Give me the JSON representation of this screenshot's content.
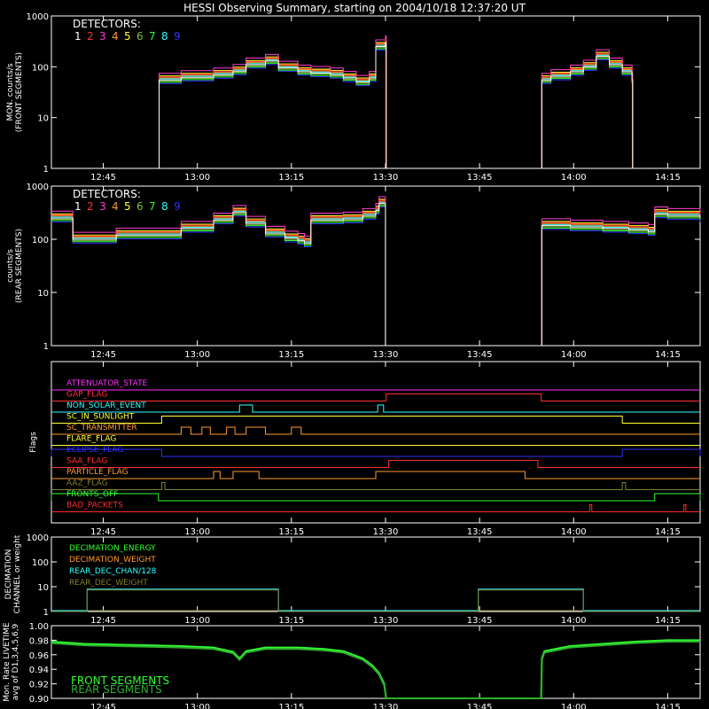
{
  "title": "HESSI Observing Summary, starting on 2004/10/18 12:37:20 UT",
  "colors": {
    "det": [
      "#ffffff",
      "#ff3030",
      "#ff3fd0",
      "#ff9a30",
      "#ffff30",
      "#7fbf3f",
      "#30ff30",
      "#30ffff",
      "#3030ff"
    ],
    "axis": "#ffffff"
  },
  "detectors_label": "DETECTORS:",
  "detector_numbers": [
    "1",
    "2",
    "3",
    "4",
    "5",
    "6",
    "7",
    "8",
    "9"
  ],
  "time_ticks": [
    "12:45",
    "13:00",
    "13:15",
    "13:30",
    "13:45",
    "14:00",
    "14:15"
  ],
  "chart_data": [
    {
      "id": "front",
      "type": "line",
      "ylabel": [
        "MON. counts/s",
        "(FRONT SEGMENTS)"
      ],
      "yscale": "log",
      "ylim": [
        1,
        1000
      ],
      "yticks": [
        "1",
        "10",
        "100",
        "1000"
      ],
      "xlim_min": [
        0,
        100
      ],
      "series_template": {
        "x": [
          0,
          16.5,
          16.6,
          20,
          25,
          28,
          30,
          33,
          35,
          38,
          40,
          43,
          45,
          47,
          49,
          50,
          51.5,
          51.6,
          75.5,
          75.6,
          77,
          80,
          82,
          84,
          86,
          88,
          89.5,
          89.6,
          100
        ],
        "y": [
          1,
          1,
          55,
          62,
          70,
          82,
          110,
          130,
          95,
          80,
          75,
          70,
          60,
          50,
          60,
          250,
          300,
          1,
          1,
          55,
          65,
          80,
          100,
          160,
          110,
          80,
          55,
          1,
          1
        ]
      }
    },
    {
      "id": "rear",
      "type": "line",
      "ylabel": [
        "counts/s",
        "(REAR SEGMENTS)"
      ],
      "yscale": "log",
      "ylim": [
        1,
        1000
      ],
      "yticks": [
        "1",
        "10",
        "100",
        "1000"
      ],
      "series_template": {
        "x": [
          0,
          3.2,
          3.3,
          10,
          20,
          25,
          28,
          30,
          33,
          36,
          38,
          39,
          40,
          45,
          48,
          50,
          50.5,
          51.5,
          51.6,
          75.5,
          75.6,
          80,
          85,
          89,
          92,
          93,
          95,
          100
        ],
        "y": [
          250,
          250,
          100,
          120,
          160,
          230,
          320,
          200,
          130,
          105,
          95,
          85,
          230,
          240,
          280,
          350,
          470,
          1,
          1,
          1,
          180,
          170,
          160,
          150,
          140,
          300,
          280,
          250
        ]
      }
    }
  ],
  "flags": {
    "ylabel": "Flags",
    "rows": [
      {
        "label": "ATTENUATOR_STATE",
        "color": "#ff30ff",
        "segments": []
      },
      {
        "label": "GAP_FLAG",
        "color": "#ff3030",
        "segments": [
          [
            51.6,
            75.5
          ]
        ]
      },
      {
        "label": "NON_SOLAR_EVENT",
        "color": "#30ffff",
        "segments": [
          [
            29.0,
            31.0
          ],
          [
            50.3,
            51.2
          ]
        ]
      },
      {
        "label": "SC_IN_SUNLIGHT",
        "color": "#ffff30",
        "segments": [
          [
            17.0,
            88.0
          ]
        ]
      },
      {
        "label": "SC_TRANSMITTER",
        "color": "#ff9a30",
        "segments": [
          [
            20.0,
            21.5
          ],
          [
            23.2,
            24.5
          ],
          [
            27.0,
            28.3
          ],
          [
            30.0,
            33.0
          ],
          [
            37.0,
            38.5
          ]
        ]
      },
      {
        "label": "FLARE_FLAG",
        "color": "#ffff30",
        "segments": []
      },
      {
        "label": "ECLIPSE_FLAG",
        "color": "#3030ff",
        "segments": [
          [
            0,
            17.0
          ],
          [
            88.0,
            100
          ]
        ]
      },
      {
        "label": "SAA_FLAG",
        "color": "#ff3030",
        "segments": [
          [
            52.0,
            75.0
          ]
        ]
      },
      {
        "label": "PARTICLE_FLAG",
        "color": "#ff9a30",
        "segments": [
          [
            25.0,
            26.0
          ],
          [
            28.0,
            32.0
          ],
          [
            50.0,
            73.0
          ]
        ]
      },
      {
        "label": "AAZ_FLAG",
        "color": "#7f7f30",
        "segments": [
          [
            17.0,
            17.5
          ],
          [
            88.0,
            88.5
          ]
        ]
      },
      {
        "label": "FRONTS_OFF",
        "color": "#30ff30",
        "segments": [
          [
            0,
            16.5
          ],
          [
            93.0,
            100
          ]
        ]
      },
      {
        "label": "BAD_PACKETS",
        "color": "#ff3030",
        "segments": [
          [
            83.0,
            83.3
          ],
          [
            97.5,
            97.8
          ]
        ]
      }
    ]
  },
  "decimation": {
    "ylabel": [
      "DECIMATION",
      "CHANNEL or weight"
    ],
    "yticks": [
      "1",
      "10",
      "100",
      "1000"
    ],
    "legend": [
      {
        "label": "DECIMATION_ENERGY",
        "color": "#30ff30"
      },
      {
        "label": "DECIMATION_WEIGHT",
        "color": "#ff9a30"
      },
      {
        "label": "REAR_DEC_CHAN/128",
        "color": "#30ffff"
      },
      {
        "label": "REAR_DEC_WEIGHT",
        "color": "#7f7f30"
      }
    ],
    "rear_chan_segments": [
      [
        5.5,
        35.0
      ],
      [
        65.8,
        82.0
      ]
    ],
    "rear_chan_level": 8,
    "baseline": 1
  },
  "livetime": {
    "ylabel": [
      "Mon. Rate LIVETIME",
      "avg of D1,3,4,5,6,9"
    ],
    "yticks": [
      "0.90",
      "0.92",
      "0.94",
      "0.96",
      "0.98",
      "1.00"
    ],
    "ylim": [
      0.9,
      1.0
    ],
    "legend": [
      {
        "label": "FRONT SEGMENTS",
        "color": "#30ff30"
      },
      {
        "label": "REAR SEGMENTS",
        "color": "#2faf2f"
      }
    ],
    "x": [
      0,
      5,
      10,
      15,
      20,
      25,
      28,
      29,
      30,
      33,
      38,
      42,
      45,
      48,
      49.5,
      50.5,
      51.3,
      51.6,
      75.5,
      75.6,
      76,
      80,
      85,
      90,
      95,
      100
    ],
    "y": [
      0.978,
      0.975,
      0.974,
      0.973,
      0.972,
      0.97,
      0.964,
      0.955,
      0.965,
      0.97,
      0.97,
      0.968,
      0.965,
      0.955,
      0.945,
      0.935,
      0.92,
      0.9,
      0.9,
      0.955,
      0.965,
      0.972,
      0.975,
      0.978,
      0.98,
      0.98
    ]
  }
}
